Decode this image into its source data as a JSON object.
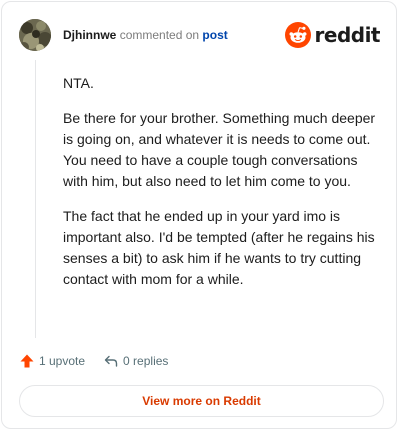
{
  "header": {
    "username": "Djhinnwe",
    "action_text": "commented on",
    "post_link": "post"
  },
  "brand": {
    "icon": "reddit-snoo-icon",
    "wordmark": "reddit",
    "accent_color": "#ff4500"
  },
  "comment": {
    "paragraphs": [
      "NTA.",
      "Be there for your brother. Something much deeper is going on, and whatever it is needs to come out. You need to have a couple tough conversations with him, but also need to let him come to you.",
      "The fact that he ended up in your yard imo is important also. I'd be tempted (after he regains his senses a bit) to ask him if he wants to try cutting contact with mom for a while."
    ]
  },
  "actions": {
    "upvote_icon": "upvote-arrow-icon",
    "upvote_label": "1 upvote",
    "reply_icon": "reply-arrow-icon",
    "replies_label": "0 replies"
  },
  "footer": {
    "view_more_label": "View more on Reddit"
  },
  "colors": {
    "upvote": "#ff4500",
    "link": "#0045ac",
    "view_more": "#d93a00",
    "muted": "#576f76"
  }
}
